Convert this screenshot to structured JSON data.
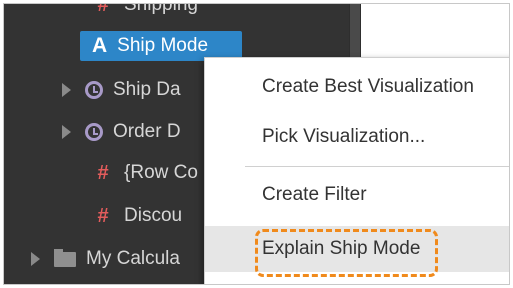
{
  "tree": {
    "top_partial_label": "Shipping",
    "selected_item": {
      "icon": "A",
      "label": "Ship Mode"
    },
    "items": [
      {
        "label": "Ship Da",
        "icon": "clock-icon"
      },
      {
        "label": "Order D",
        "icon": "clock-icon"
      },
      {
        "label": "{Row Co",
        "icon": "hash-icon"
      },
      {
        "label": "Discou",
        "icon": "hash-icon"
      },
      {
        "label": "My Calcula",
        "icon": "folder-icon"
      }
    ]
  },
  "context_menu": {
    "items": [
      {
        "label": "Create Best Visualization"
      },
      {
        "label": "Pick Visualization..."
      },
      {
        "label": "Create Filter"
      },
      {
        "label": "Explain Ship Mode"
      }
    ],
    "hovered_index": 3
  },
  "colors": {
    "panel_bg": "#333333",
    "selection": "#2d86c8",
    "highlight_outline": "#f08a1c",
    "date_icon": "#a89ac8",
    "measure_icon": "#e35c5c"
  }
}
